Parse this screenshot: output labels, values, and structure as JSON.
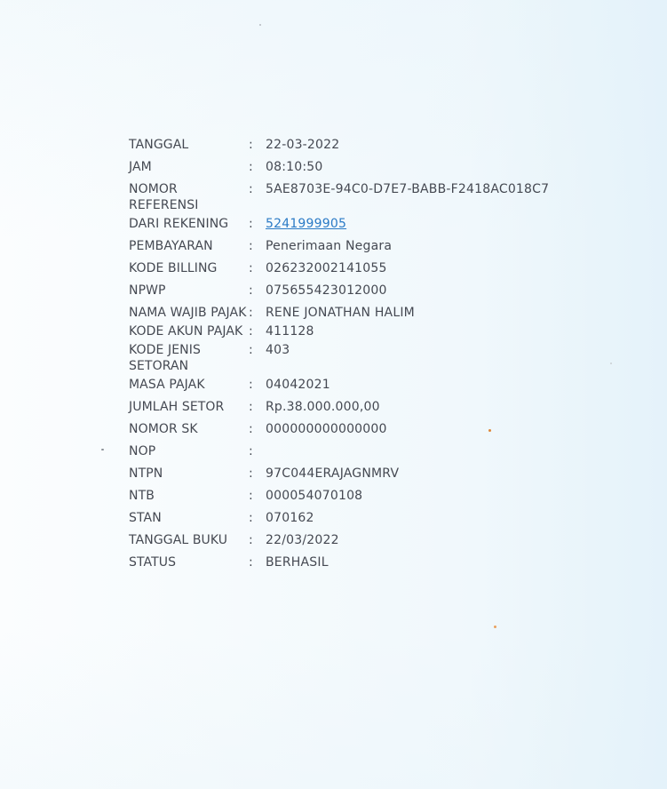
{
  "receipt": {
    "rows": [
      {
        "label": "TANGGAL",
        "value": "22-03-2022"
      },
      {
        "label": "JAM",
        "value": "08:10:50"
      },
      {
        "label": "NOMOR REFERENSI",
        "value": "5AE8703E-94C0-D7E7-BABB-F2418AC018C7"
      },
      {
        "label": "DARI REKENING",
        "value": "5241999905"
      },
      {
        "label": "PEMBAYARAN",
        "value": "Penerimaan Negara"
      },
      {
        "label": "KODE BILLING",
        "value": "026232002141055"
      },
      {
        "label": "NPWP",
        "value": "075655423012000"
      },
      {
        "label": "NAMA WAJIB PAJAK",
        "value": "RENE JONATHAN HALIM"
      },
      {
        "label": "KODE AKUN PAJAK",
        "value": "411128"
      },
      {
        "label": "KODE JENIS SETORAN",
        "value": "403"
      },
      {
        "label": "MASA PAJAK",
        "value": "04042021"
      },
      {
        "label": "JUMLAH SETOR",
        "value": "Rp.38.000.000,00"
      },
      {
        "label": "NOMOR SK",
        "value": "000000000000000"
      },
      {
        "label": "NOP",
        "value": ""
      },
      {
        "label": "NTPN",
        "value": "97C044ERAJAGNMRV"
      },
      {
        "label": "NTB",
        "value": "000054070108"
      },
      {
        "label": "STAN",
        "value": "070162"
      },
      {
        "label": "TANGGAL BUKU",
        "value": "22/03/2022"
      },
      {
        "label": "STATUS",
        "value": "BERHASIL"
      }
    ],
    "separator": ":"
  },
  "colors": {
    "text": "#454952",
    "link": "#2b7bc6",
    "background": "#fbfdfe",
    "speck": "#e0873a"
  }
}
